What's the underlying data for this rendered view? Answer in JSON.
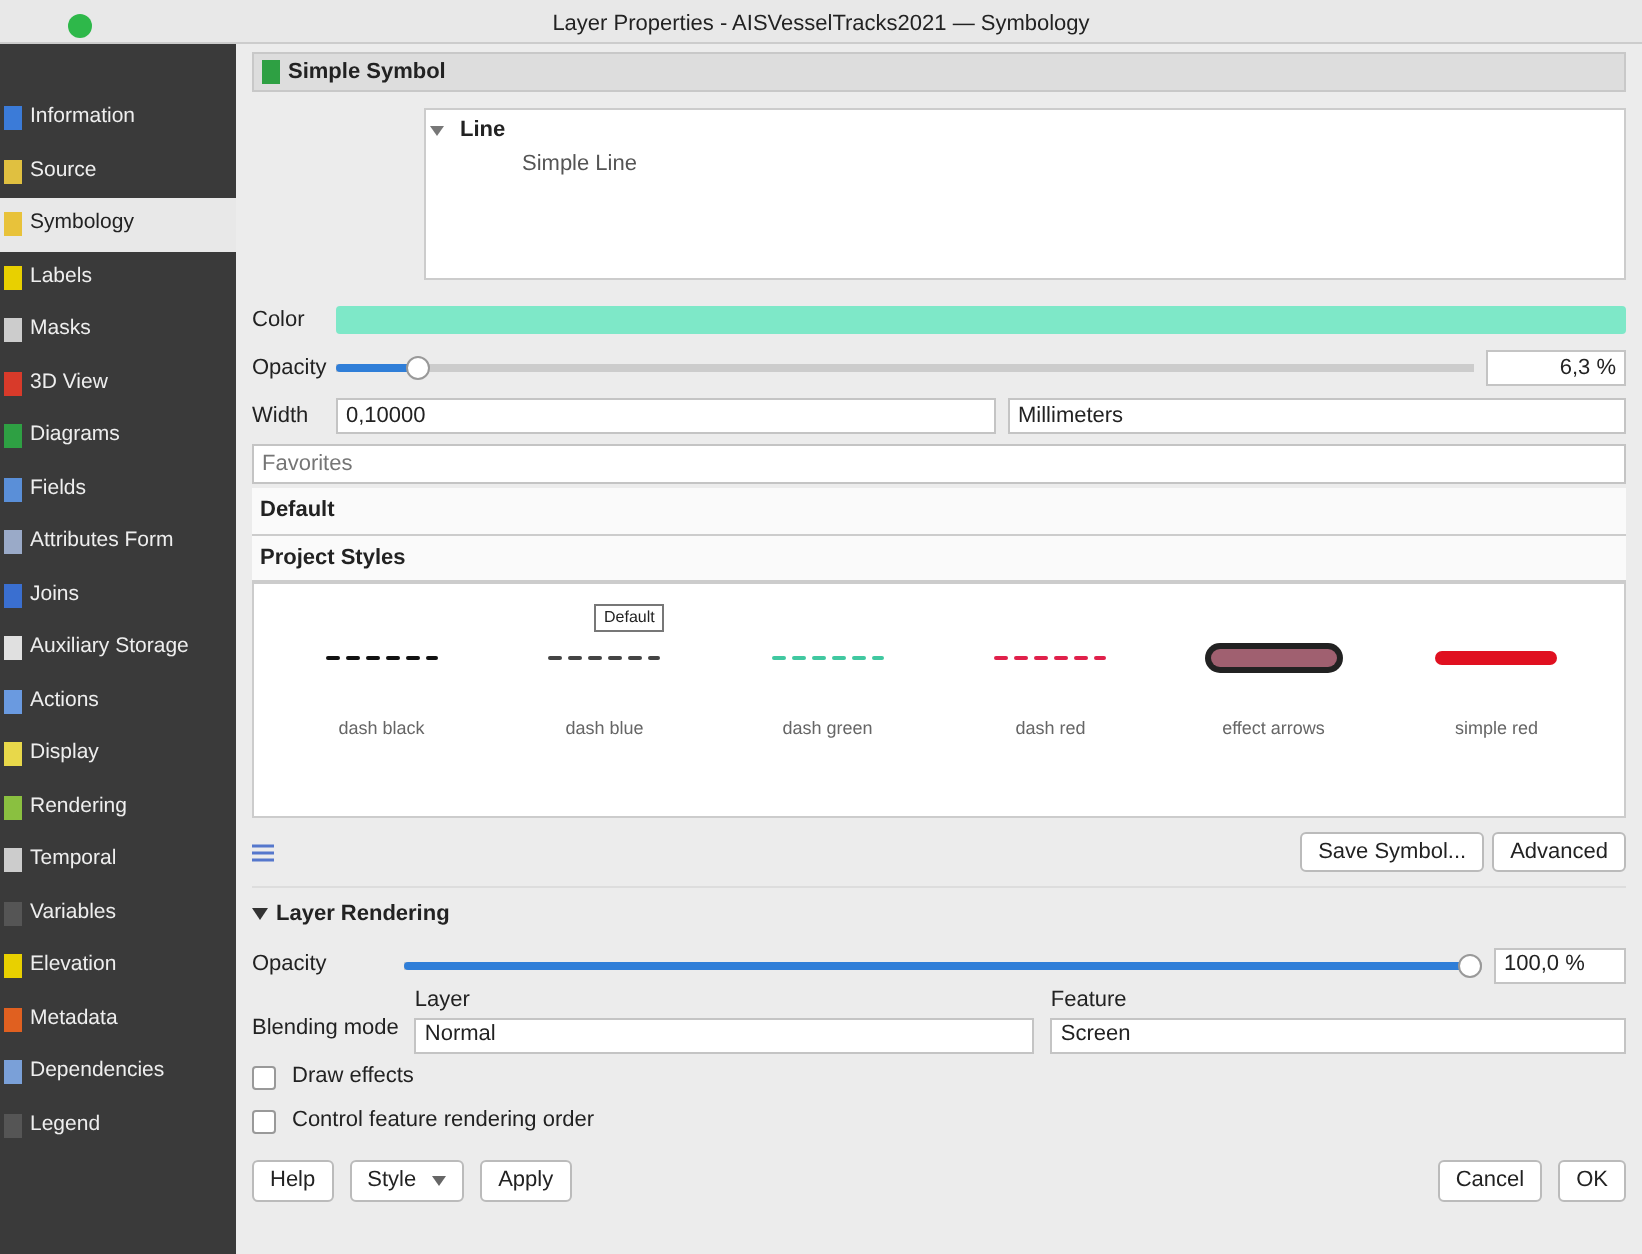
{
  "window": {
    "title": "Layer Properties - AISVesselTracks2021 — Symbology"
  },
  "sidebar": {
    "items": [
      {
        "label": "Information",
        "selected": false,
        "color": "#3b7bd8"
      },
      {
        "label": "Source",
        "selected": false,
        "color": "#e0c040"
      },
      {
        "label": "Symbology",
        "selected": true,
        "color": "#e8c23a"
      },
      {
        "label": "Labels",
        "selected": false,
        "color": "#e8d000"
      },
      {
        "label": "Masks",
        "selected": false,
        "color": "#cccccc"
      },
      {
        "label": "3D View",
        "selected": false,
        "color": "#d83a2a"
      },
      {
        "label": "Diagrams",
        "selected": false,
        "color": "#2ea043"
      },
      {
        "label": "Fields",
        "selected": false,
        "color": "#5a8fd8"
      },
      {
        "label": "Attributes Form",
        "selected": false,
        "color": "#9aaac8"
      },
      {
        "label": "Joins",
        "selected": false,
        "color": "#3a6fd0"
      },
      {
        "label": "Auxiliary Storage",
        "selected": false,
        "color": "#e0e0e0"
      },
      {
        "label": "Actions",
        "selected": false,
        "color": "#6a9ae0"
      },
      {
        "label": "Display",
        "selected": false,
        "color": "#e8d84a"
      },
      {
        "label": "Rendering",
        "selected": false,
        "color": "#8ac040"
      },
      {
        "label": "Temporal",
        "selected": false,
        "color": "#cccccc"
      },
      {
        "label": "Variables",
        "selected": false,
        "color": "#555555"
      },
      {
        "label": "Elevation",
        "selected": false,
        "color": "#e8d000"
      },
      {
        "label": "Metadata",
        "selected": false,
        "color": "#e06020"
      },
      {
        "label": "Dependencies",
        "selected": false,
        "color": "#7aa0d8"
      },
      {
        "label": "Legend",
        "selected": false,
        "color": "#555555"
      }
    ]
  },
  "renderer": {
    "label": "Simple Symbol"
  },
  "symbol_tree": [
    {
      "label": "Line",
      "expanded": true,
      "children": [
        {
          "label": "Simple Line"
        }
      ]
    }
  ],
  "color": {
    "label": "Color"
  },
  "opacity": {
    "label": "Opacity",
    "level": 0.063,
    "reading": "6,3 %"
  },
  "width": {
    "label": "Width",
    "value": "0,10000",
    "unit": "Millimeters"
  },
  "search": {
    "placeholder": "Favorites"
  },
  "groups": [
    "Default",
    "Project Styles"
  ],
  "tooltip": "Default",
  "styles": [
    {
      "name": "dash black",
      "kind": "dash",
      "color": "#111111"
    },
    {
      "name": "dash blue",
      "kind": "dash",
      "color": "#444444"
    },
    {
      "name": "dash green",
      "kind": "dash",
      "color": "#40c8a0"
    },
    {
      "name": "dash red",
      "kind": "dash",
      "color": "#e0204a"
    },
    {
      "name": "effect arrows",
      "kind": "glow",
      "color": "#a06070"
    },
    {
      "name": "simple red",
      "kind": "solid",
      "color": "#e01020"
    }
  ],
  "save_symbol": "Save Symbol...",
  "advanced": "Advanced",
  "layer_rendering": {
    "title": "Layer Rendering",
    "expanded": true,
    "opacity_label": "Opacity",
    "level": 1,
    "reading": "100,0 %",
    "blending_label": "Blending mode",
    "layer_label": "Layer",
    "layer_value": "Normal",
    "feature_label": "Feature",
    "feature_value": "Screen",
    "options": [
      {
        "label": "Draw effects",
        "checked": false
      },
      {
        "label": "Control feature rendering order",
        "checked": false
      }
    ]
  },
  "buttons": [
    {
      "label": "Help",
      "has_menu": false
    },
    {
      "label": "Style",
      "has_menu": true
    },
    {
      "label": "Apply",
      "has_menu": false
    },
    {
      "label": "Cancel",
      "has_menu": false
    },
    {
      "label": "OK",
      "has_menu": false
    }
  ]
}
